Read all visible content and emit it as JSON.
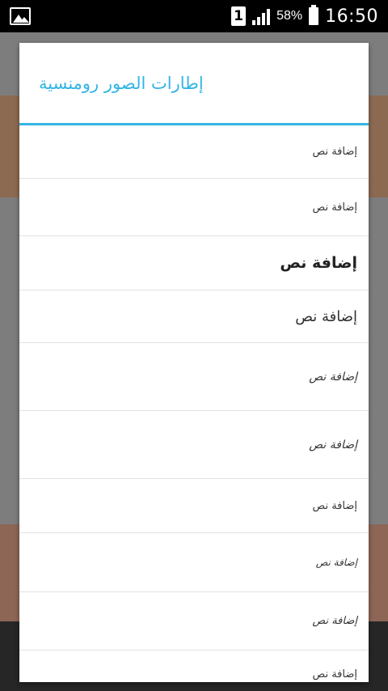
{
  "status_bar": {
    "notification_icon": "image-icon",
    "sim_label": "1",
    "signal_icon": "signal-icon",
    "battery_percent": "58%",
    "battery_icon": "battery-icon",
    "time": "16:50"
  },
  "dialog": {
    "title": "إطارات الصور رومنسية",
    "accent_color": "#33b5e5",
    "items": [
      {
        "label": "إضافة نص"
      },
      {
        "label": "إضافة نص"
      },
      {
        "label": "إضافة نص"
      },
      {
        "label": "إضافة نص"
      },
      {
        "label": "إضافة نص"
      },
      {
        "label": "إضافة نص"
      },
      {
        "label": "إضافة نص"
      },
      {
        "label": "إضافة نص"
      },
      {
        "label": "إضافة نص"
      },
      {
        "label": "إضافة نص"
      }
    ]
  }
}
